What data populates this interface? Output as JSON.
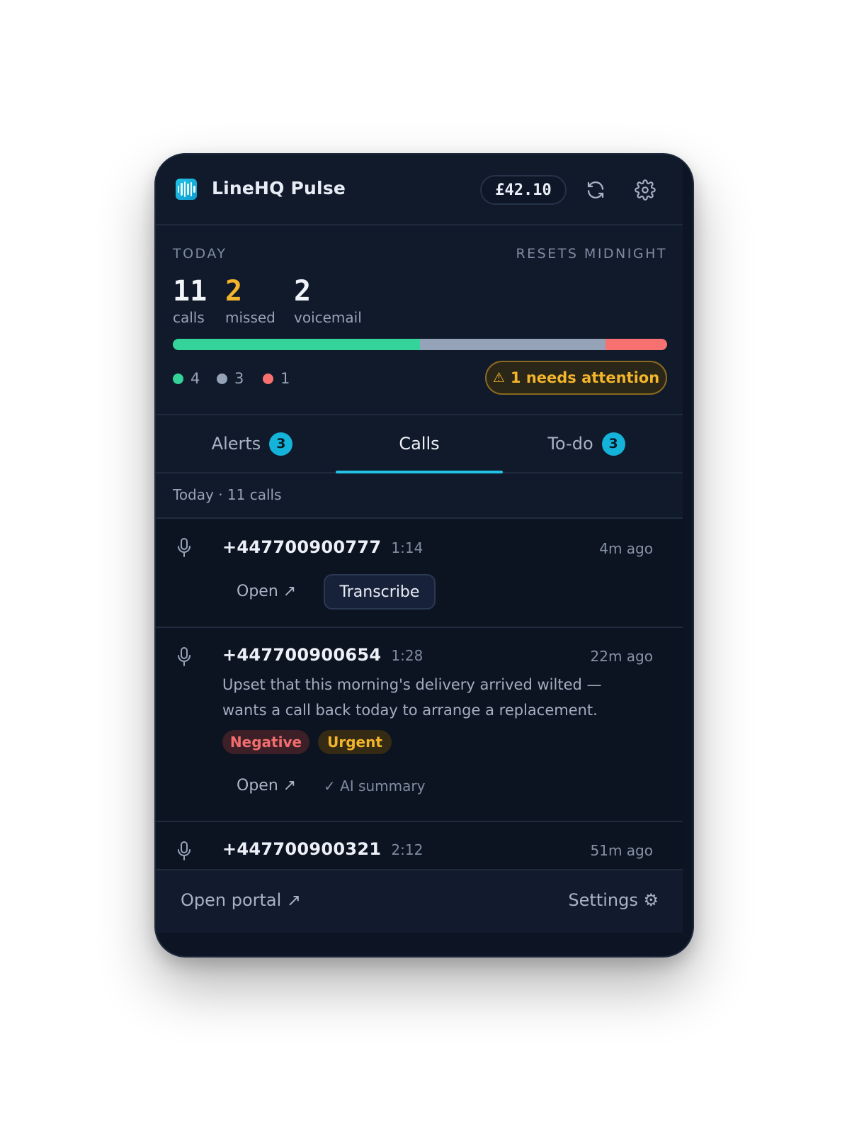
{
  "app": {
    "title": "LineHQ Pulse",
    "balance": "£42.10"
  },
  "icons": {
    "refresh": "refresh-icon",
    "settings": "gear-icon",
    "logo": "waveform-icon"
  },
  "today": {
    "label": "TODAY",
    "resets": "RESETS MIDNIGHT",
    "stats": [
      {
        "value": "11",
        "label": "calls",
        "color": "#f1f4f8"
      },
      {
        "value": "2",
        "label": "missed",
        "color": "#f3b52b"
      },
      {
        "value": "2",
        "label": "voicemail",
        "color": "#f1f4f8"
      }
    ],
    "breakdown": [
      {
        "count": "4",
        "color": "#34d399"
      },
      {
        "count": "3",
        "color": "#94a3b8"
      },
      {
        "count": "1",
        "color": "#f87171"
      }
    ],
    "attention": "1 needs attention",
    "attention_icon": "⚠"
  },
  "tabs": [
    {
      "label": "Alerts",
      "badge": "3"
    },
    {
      "label": "Calls",
      "badge": ""
    },
    {
      "label": "To-do",
      "badge": "3"
    }
  ],
  "list": {
    "header": "Today · 11 calls",
    "calls": [
      {
        "number": "+447700900777",
        "duration": "1:14",
        "ago": "4m ago",
        "open": "Open ↗",
        "action": "Transcribe"
      },
      {
        "number": "+447700900654",
        "duration": "1:28",
        "ago": "22m ago",
        "summary": "Upset that this morning's delivery arrived wilted — wants a call back today to arrange a replacement.",
        "tags": [
          "Negative",
          "Urgent"
        ],
        "open": "Open ↗",
        "ai_summary": "✓ AI summary"
      },
      {
        "number": "+447700900321",
        "duration": "2:12",
        "ago": "51m ago"
      }
    ]
  },
  "footer": {
    "open_portal": "Open portal ↗",
    "settings": "Settings ⚙"
  }
}
